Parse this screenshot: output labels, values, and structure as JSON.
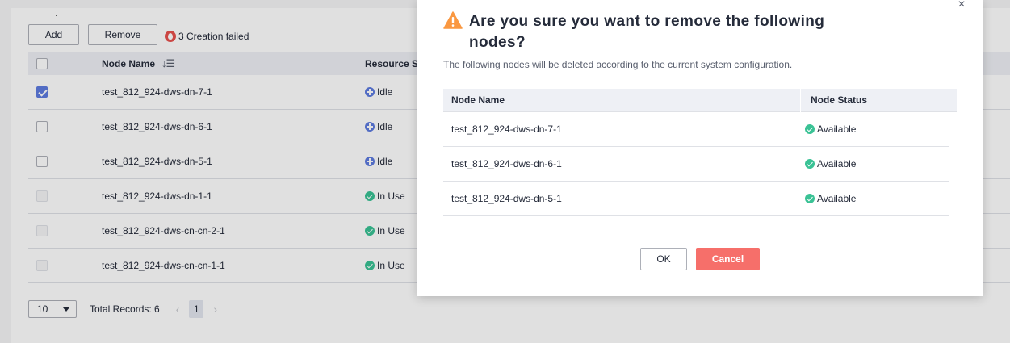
{
  "toolbar": {
    "add_label": "Add",
    "remove_label": "Remove",
    "failed_text": "3 Creation failed"
  },
  "table": {
    "headers": {
      "node_name": "Node Name",
      "resource_status": "Resource St"
    },
    "rows": [
      {
        "name": "test_812_924-dws-dn-7-1",
        "status": "Idle",
        "checked": true,
        "disabled": false
      },
      {
        "name": "test_812_924-dws-dn-6-1",
        "status": "Idle",
        "checked": false,
        "disabled": false
      },
      {
        "name": "test_812_924-dws-dn-5-1",
        "status": "Idle",
        "checked": false,
        "disabled": false
      },
      {
        "name": "test_812_924-dws-dn-1-1",
        "status": "In Use",
        "checked": false,
        "disabled": true
      },
      {
        "name": "test_812_924-dws-cn-cn-2-1",
        "status": "In Use",
        "checked": false,
        "disabled": true
      },
      {
        "name": "test_812_924-dws-cn-cn-1-1",
        "status": "In Use",
        "checked": false,
        "disabled": true
      }
    ]
  },
  "pagination": {
    "page_size": "10",
    "total_records": "Total Records: 6",
    "current_page": "1"
  },
  "dialog": {
    "title": "Are you sure you want to remove the following nodes?",
    "description": "The following nodes will be deleted according to the current system configuration.",
    "headers": {
      "node_name": "Node Name",
      "node_status": "Node Status"
    },
    "rows": [
      {
        "name": "test_812_924-dws-dn-7-1",
        "status": "Available"
      },
      {
        "name": "test_812_924-dws-dn-6-1",
        "status": "Available"
      },
      {
        "name": "test_812_924-dws-dn-5-1",
        "status": "Available"
      }
    ],
    "ok_label": "OK",
    "cancel_label": "Cancel",
    "close_glyph": "×"
  },
  "colors": {
    "primary": "#5e7ce0",
    "success": "#3ac295",
    "danger": "#f66f6a",
    "warning": "#fa9841"
  }
}
